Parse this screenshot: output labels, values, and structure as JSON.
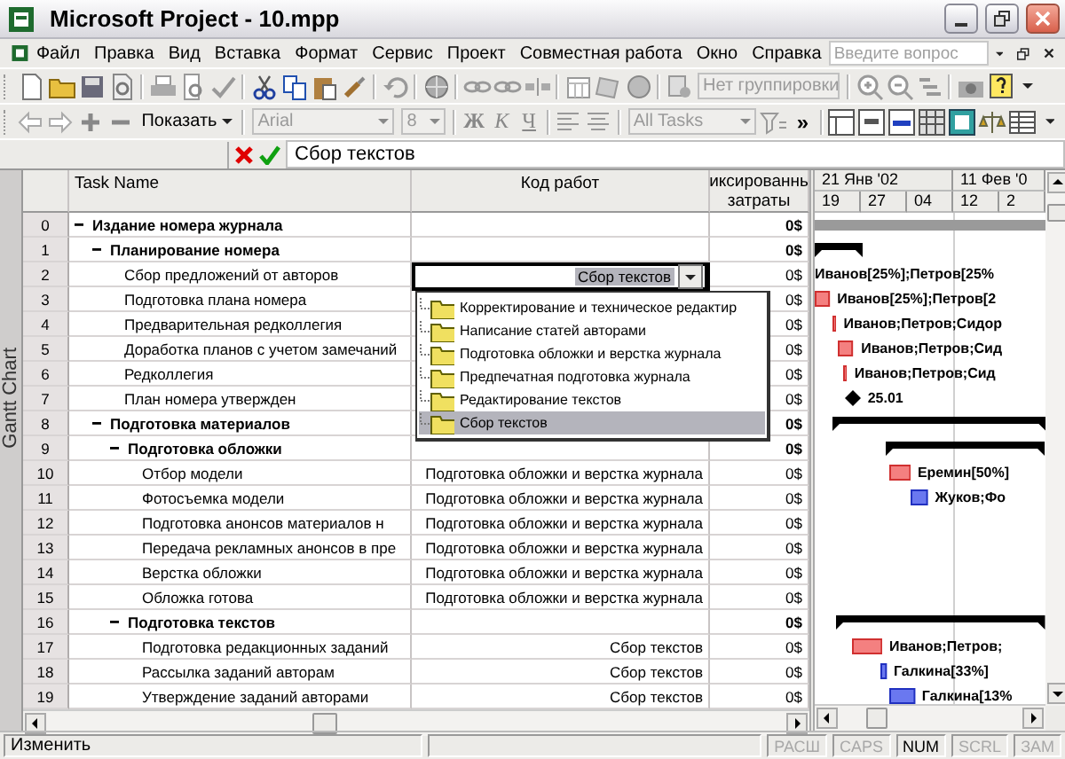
{
  "window": {
    "title": "Microsoft Project - 10.mpp"
  },
  "menu": {
    "items": [
      "Файл",
      "Правка",
      "Вид",
      "Вставка",
      "Формат",
      "Сервис",
      "Проект",
      "Совместная работа",
      "Окно",
      "Справка"
    ],
    "help_search": {
      "placeholder": "Введите вопрос"
    }
  },
  "toolbar": {
    "grouping": {
      "value": "Нет группировки",
      "disabled": true
    }
  },
  "formatting_toolbar": {
    "show_button": "Показать",
    "font": {
      "value": "Arial",
      "disabled": true
    },
    "font_size": {
      "value": "8",
      "disabled": true
    },
    "style_buttons": [
      {
        "label": "Ж",
        "kind": "bold"
      },
      {
        "label": "К",
        "kind": "italic"
      },
      {
        "label": "Ч",
        "kind": "underline"
      }
    ],
    "filter": {
      "value": "All Tasks",
      "disabled": true
    },
    "more": "»"
  },
  "entry_bar": {
    "value": "Сбор текстов"
  },
  "view_bar": {
    "label": "Gantt Chart"
  },
  "table": {
    "columns": [
      "Task Name",
      "Код работ",
      "иксированнь\nзатраты"
    ],
    "rows": [
      {
        "number": "0",
        "name": "Издание номера журнала",
        "summary": true,
        "expanded": true,
        "cost": "0$",
        "bar": {
          "kind": "project"
        },
        "children": [
          {
            "number": "1",
            "name": "Планирование номера",
            "summary": true,
            "expanded": true,
            "cost": "0$",
            "bar": {
              "kind": "summary"
            },
            "children": [
              {
                "number": "2",
                "name": "Сбор предложений от авторов",
                "summary": false,
                "editing": true,
                "cost": "0$",
                "bar": {
                  "label": "Иванов[25%];Петров[25%"
                }
              },
              {
                "number": "3",
                "name": "Подготовка плана номера",
                "summary": false,
                "cost": "0$",
                "bar": {
                  "kind": "task",
                  "critical": true,
                  "label": "Иванов[25%];Петров[2"
                }
              },
              {
                "number": "4",
                "name": "Предварительная редколлегия",
                "summary": false,
                "cost": "0$",
                "bar": {
                  "kind": "task",
                  "critical": true,
                  "label": "Иванов;Петров;Сидор"
                }
              },
              {
                "number": "5",
                "name": "Доработка планов с учетом замечаний",
                "summary": false,
                "cost": "0$",
                "bar": {
                  "kind": "task",
                  "critical": true,
                  "label": "Иванов;Петров;Сид"
                }
              },
              {
                "number": "6",
                "name": "Редколлегия",
                "summary": false,
                "cost": "0$",
                "bar": {
                  "kind": "task",
                  "critical": true,
                  "label": "Иванов;Петров;Сид"
                }
              },
              {
                "number": "7",
                "name": "План номера утвержден",
                "summary": false,
                "cost": "0$",
                "bar": {
                  "kind": "milestone",
                  "label": "25.01"
                }
              }
            ]
          },
          {
            "number": "8",
            "name": "Подготовка материалов",
            "summary": true,
            "expanded": true,
            "cost": "0$",
            "bar": {
              "kind": "summary"
            },
            "children": [
              {
                "number": "9",
                "name": "Подготовка обложки",
                "summary": true,
                "expanded": true,
                "cost": "0$",
                "bar": {
                  "kind": "summary"
                },
                "children": [
                  {
                    "number": "10",
                    "name": "Отбор модели",
                    "summary": false,
                    "code": "Подготовка обложки и верстка журнала",
                    "cost": "0$",
                    "bar": {
                      "kind": "task",
                      "critical": true,
                      "label": "Еремин[50%]"
                    }
                  },
                  {
                    "number": "11",
                    "name": "Фотосъемка модели",
                    "summary": false,
                    "code": "Подготовка обложки и верстка журнала",
                    "cost": "0$",
                    "bar": {
                      "kind": "task",
                      "critical": false,
                      "label": "Жуков;Фо"
                    }
                  },
                  {
                    "number": "12",
                    "name": "Подготовка анонсов материалов н",
                    "summary": false,
                    "code": "Подготовка обложки и верстка журнала",
                    "cost": "0$"
                  },
                  {
                    "number": "13",
                    "name": "Передача рекламных анонсов в пре",
                    "summary": false,
                    "code": "Подготовка обложки и верстка журнала",
                    "cost": "0$"
                  },
                  {
                    "number": "14",
                    "name": "Верстка обложки",
                    "summary": false,
                    "code": "Подготовка обложки и верстка журнала",
                    "cost": "0$"
                  },
                  {
                    "number": "15",
                    "name": "Обложка готова",
                    "summary": false,
                    "code": "Подготовка обложки и верстка журнала",
                    "cost": "0$"
                  }
                ]
              },
              {
                "number": "16",
                "name": "Подготовка текстов",
                "summary": true,
                "expanded": true,
                "cost": "0$",
                "bar": {
                  "kind": "summary"
                },
                "children": [
                  {
                    "number": "17",
                    "name": "Подготовка редакционных заданий",
                    "summary": false,
                    "code": "Сбор текстов",
                    "cost": "0$",
                    "bar": {
                      "kind": "task",
                      "critical": true,
                      "label": "Иванов;Петров;"
                    }
                  },
                  {
                    "number": "18",
                    "name": "Рассылка заданий авторам",
                    "summary": false,
                    "code": "Сбор текстов",
                    "cost": "0$",
                    "bar": {
                      "kind": "task",
                      "critical": false,
                      "label": "Галкина[33%]"
                    }
                  },
                  {
                    "number": "19",
                    "name": "Утверждение заданий авторами",
                    "summary": false,
                    "code": "Сбор текстов",
                    "cost": "0$",
                    "bar": {
                      "kind": "task",
                      "critical": false,
                      "label": "Галкина[13%"
                    }
                  }
                ]
              }
            ]
          }
        ]
      }
    ]
  },
  "code_editor": {
    "value": "Сбор текстов",
    "options": [
      {
        "label": "Корректирование и техническое редактир",
        "selected": false
      },
      {
        "label": "Написание статей авторами",
        "selected": false
      },
      {
        "label": "Подготовка обложки и верстка журнала",
        "selected": false
      },
      {
        "label": "Предпечатная подготовка журнала",
        "selected": false
      },
      {
        "label": "Редактирование текстов",
        "selected": false
      },
      {
        "label": "Сбор текстов",
        "selected": true
      }
    ]
  },
  "timescale": {
    "major": [
      "21 Янв '02",
      "11 Фев '0"
    ],
    "minor": [
      "19",
      "27",
      "04",
      "12",
      "2"
    ]
  },
  "status_bar": {
    "message": "Изменить",
    "indicators": [
      {
        "label": "РАСШ",
        "on": false
      },
      {
        "label": "CAPS",
        "on": false
      },
      {
        "label": "NUM",
        "on": true
      },
      {
        "label": "SCRL",
        "on": false
      },
      {
        "label": "ЗАМ",
        "on": false
      }
    ]
  }
}
